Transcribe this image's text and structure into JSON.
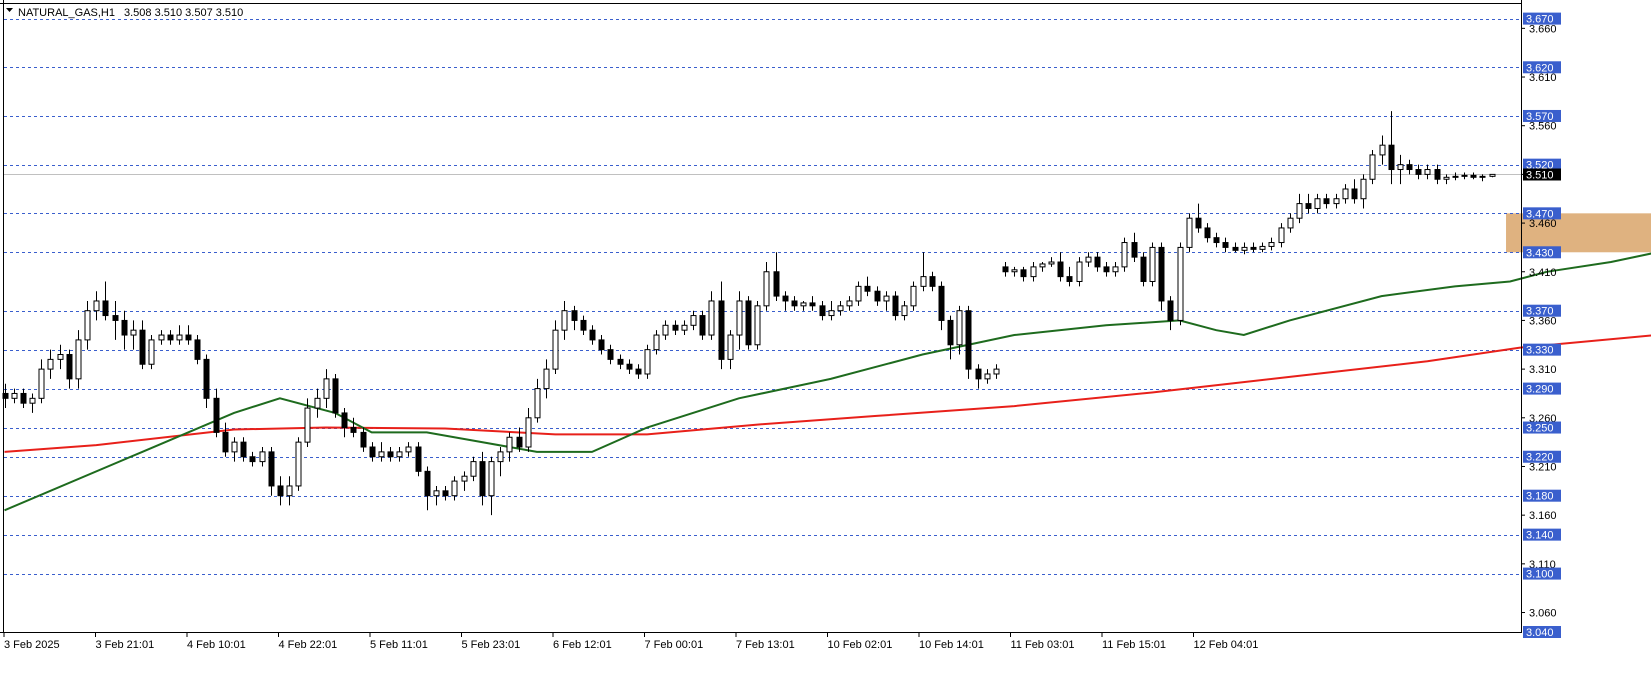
{
  "header": {
    "symbol": "NATURAL_GAS,H1",
    "ohlc": "3.508 3.510 3.507 3.510"
  },
  "colors": {
    "background": "#ffffff",
    "grid_dashed": "#3a5fcd",
    "level_label_bg": "#3a5fcd",
    "ma_fast": "#1e6b1e",
    "ma_slow": "#e8201a",
    "zone_fill": "#d9a56a",
    "bull_fill": "#ffffff",
    "bear_fill": "#000000",
    "candle_outline": "#000000",
    "current_price_bg": "#000000"
  },
  "chart_data": {
    "type": "candlestick",
    "symbol": "NATURAL_GAS",
    "timeframe": "H1",
    "ylim": [
      3.04,
      3.685
    ],
    "y_ticks": [
      "3.660",
      "3.610",
      "3.560",
      "3.510",
      "3.460",
      "3.410",
      "3.360",
      "3.310",
      "3.260",
      "3.210",
      "3.160",
      "3.110",
      "3.060"
    ],
    "levels": [
      "3.670",
      "3.620",
      "3.570",
      "3.520",
      "3.470",
      "3.430",
      "3.370",
      "3.330",
      "3.290",
      "3.250",
      "3.220",
      "3.180",
      "3.140",
      "3.100",
      "3.040"
    ],
    "current_price": "3.510",
    "x_labels": [
      "3 Feb 2025",
      "3 Feb 21:01",
      "4 Feb 10:01",
      "4 Feb 22:01",
      "5 Feb 11:01",
      "5 Feb 23:01",
      "6 Feb 12:01",
      "7 Feb 00:01",
      "7 Feb 13:01",
      "10 Feb 02:01",
      "10 Feb 14:01",
      "11 Feb 03:01",
      "11 Feb 15:01",
      "12 Feb 04:01"
    ],
    "zone": {
      "from_price": 3.43,
      "to_price": 3.47,
      "from_bar": 164,
      "to_bar": 222
    },
    "candles": [
      [
        3.285,
        3.295,
        3.27,
        3.28
      ],
      [
        3.28,
        3.29,
        3.275,
        3.285
      ],
      [
        3.285,
        3.29,
        3.27,
        3.275
      ],
      [
        3.275,
        3.285,
        3.265,
        3.28
      ],
      [
        3.28,
        3.32,
        3.275,
        3.31
      ],
      [
        3.31,
        3.33,
        3.3,
        3.32
      ],
      [
        3.32,
        3.335,
        3.31,
        3.325
      ],
      [
        3.325,
        3.33,
        3.29,
        3.3
      ],
      [
        3.3,
        3.35,
        3.29,
        3.34
      ],
      [
        3.34,
        3.38,
        3.33,
        3.37
      ],
      [
        3.37,
        3.39,
        3.36,
        3.38
      ],
      [
        3.38,
        3.4,
        3.36,
        3.365
      ],
      [
        3.365,
        3.38,
        3.34,
        3.36
      ],
      [
        3.36,
        3.37,
        3.33,
        3.345
      ],
      [
        3.345,
        3.36,
        3.33,
        3.35
      ],
      [
        3.35,
        3.36,
        3.31,
        3.315
      ],
      [
        3.315,
        3.345,
        3.31,
        3.34
      ],
      [
        3.34,
        3.35,
        3.335,
        3.345
      ],
      [
        3.345,
        3.35,
        3.335,
        3.34
      ],
      [
        3.34,
        3.355,
        3.335,
        3.345
      ],
      [
        3.345,
        3.355,
        3.335,
        3.34
      ],
      [
        3.34,
        3.345,
        3.315,
        3.32
      ],
      [
        3.32,
        3.325,
        3.27,
        3.28
      ],
      [
        3.28,
        3.29,
        3.24,
        3.245
      ],
      [
        3.245,
        3.255,
        3.22,
        3.225
      ],
      [
        3.225,
        3.24,
        3.215,
        3.235
      ],
      [
        3.235,
        3.24,
        3.215,
        3.22
      ],
      [
        3.22,
        3.225,
        3.21,
        3.215
      ],
      [
        3.215,
        3.23,
        3.21,
        3.225
      ],
      [
        3.225,
        3.23,
        3.18,
        3.19
      ],
      [
        3.19,
        3.2,
        3.17,
        3.18
      ],
      [
        3.18,
        3.2,
        3.17,
        3.19
      ],
      [
        3.19,
        3.24,
        3.185,
        3.235
      ],
      [
        3.235,
        3.28,
        3.23,
        3.27
      ],
      [
        3.27,
        3.29,
        3.26,
        3.28
      ],
      [
        3.28,
        3.31,
        3.27,
        3.3
      ],
      [
        3.3,
        3.305,
        3.26,
        3.265
      ],
      [
        3.265,
        3.27,
        3.24,
        3.25
      ],
      [
        3.25,
        3.26,
        3.24,
        3.245
      ],
      [
        3.245,
        3.25,
        3.225,
        3.23
      ],
      [
        3.23,
        3.235,
        3.215,
        3.22
      ],
      [
        3.22,
        3.235,
        3.215,
        3.225
      ],
      [
        3.225,
        3.23,
        3.215,
        3.22
      ],
      [
        3.22,
        3.23,
        3.215,
        3.225
      ],
      [
        3.225,
        3.235,
        3.22,
        3.23
      ],
      [
        3.23,
        3.235,
        3.2,
        3.205
      ],
      [
        3.205,
        3.21,
        3.165,
        3.18
      ],
      [
        3.18,
        3.19,
        3.17,
        3.185
      ],
      [
        3.185,
        3.19,
        3.175,
        3.18
      ],
      [
        3.18,
        3.2,
        3.175,
        3.195
      ],
      [
        3.195,
        3.205,
        3.185,
        3.2
      ],
      [
        3.2,
        3.22,
        3.195,
        3.215
      ],
      [
        3.215,
        3.225,
        3.17,
        3.18
      ],
      [
        3.18,
        3.22,
        3.16,
        3.215
      ],
      [
        3.215,
        3.23,
        3.2,
        3.225
      ],
      [
        3.225,
        3.245,
        3.215,
        3.24
      ],
      [
        3.24,
        3.25,
        3.225,
        3.23
      ],
      [
        3.23,
        3.27,
        3.225,
        3.26
      ],
      [
        3.26,
        3.3,
        3.255,
        3.29
      ],
      [
        3.29,
        3.32,
        3.28,
        3.31
      ],
      [
        3.31,
        3.36,
        3.305,
        3.35
      ],
      [
        3.35,
        3.38,
        3.34,
        3.37
      ],
      [
        3.37,
        3.375,
        3.35,
        3.36
      ],
      [
        3.36,
        3.365,
        3.345,
        3.35
      ],
      [
        3.35,
        3.355,
        3.335,
        3.34
      ],
      [
        3.34,
        3.345,
        3.325,
        3.33
      ],
      [
        3.33,
        3.335,
        3.315,
        3.32
      ],
      [
        3.32,
        3.325,
        3.31,
        3.315
      ],
      [
        3.315,
        3.32,
        3.305,
        3.31
      ],
      [
        3.31,
        3.315,
        3.3,
        3.305
      ],
      [
        3.305,
        3.335,
        3.3,
        3.33
      ],
      [
        3.33,
        3.35,
        3.325,
        3.345
      ],
      [
        3.345,
        3.36,
        3.34,
        3.355
      ],
      [
        3.355,
        3.36,
        3.345,
        3.35
      ],
      [
        3.35,
        3.36,
        3.345,
        3.355
      ],
      [
        3.355,
        3.37,
        3.35,
        3.365
      ],
      [
        3.365,
        3.37,
        3.34,
        3.345
      ],
      [
        3.345,
        3.39,
        3.34,
        3.38
      ],
      [
        3.38,
        3.4,
        3.31,
        3.32
      ],
      [
        3.32,
        3.35,
        3.31,
        3.345
      ],
      [
        3.345,
        3.39,
        3.33,
        3.38
      ],
      [
        3.38,
        3.385,
        3.33,
        3.335
      ],
      [
        3.335,
        3.38,
        3.33,
        3.375
      ],
      [
        3.375,
        3.42,
        3.37,
        3.41
      ],
      [
        3.41,
        3.43,
        3.38,
        3.385
      ],
      [
        3.385,
        3.39,
        3.37,
        3.38
      ],
      [
        3.38,
        3.385,
        3.37,
        3.375
      ],
      [
        3.375,
        3.38,
        3.37,
        3.378
      ],
      [
        3.378,
        3.385,
        3.37,
        3.375
      ],
      [
        3.375,
        3.38,
        3.36,
        3.365
      ],
      [
        3.365,
        3.38,
        3.36,
        3.37
      ],
      [
        3.37,
        3.38,
        3.365,
        3.375
      ],
      [
        3.375,
        3.385,
        3.37,
        3.38
      ],
      [
        3.38,
        3.4,
        3.375,
        3.395
      ],
      [
        3.395,
        3.405,
        3.385,
        3.39
      ],
      [
        3.39,
        3.395,
        3.375,
        3.38
      ],
      [
        3.38,
        3.39,
        3.37,
        3.385
      ],
      [
        3.385,
        3.39,
        3.36,
        3.365
      ],
      [
        3.365,
        3.38,
        3.36,
        3.375
      ],
      [
        3.375,
        3.4,
        3.37,
        3.395
      ],
      [
        3.395,
        3.43,
        3.39,
        3.405
      ],
      [
        3.405,
        3.41,
        3.39,
        3.395
      ],
      [
        3.395,
        3.4,
        3.35,
        3.36
      ],
      [
        3.36,
        3.365,
        3.32,
        3.335
      ],
      [
        3.335,
        3.375,
        3.325,
        3.37
      ],
      [
        3.37,
        3.375,
        3.3,
        3.31
      ],
      [
        3.31,
        3.315,
        3.29,
        3.3
      ],
      [
        3.3,
        3.31,
        3.295,
        3.305
      ],
      [
        3.305,
        3.315,
        3.3,
        3.31
      ],
      [
        3.415,
        3.42,
        3.405,
        3.41
      ],
      [
        3.41,
        3.415,
        3.405,
        3.412
      ],
      [
        3.412,
        3.415,
        3.4,
        3.405
      ],
      [
        3.405,
        3.42,
        3.4,
        3.415
      ],
      [
        3.415,
        3.42,
        3.41,
        3.418
      ],
      [
        3.418,
        3.425,
        3.415,
        3.42
      ],
      [
        3.42,
        3.43,
        3.4,
        3.405
      ],
      [
        3.405,
        3.415,
        3.395,
        3.4
      ],
      [
        3.4,
        3.425,
        3.395,
        3.42
      ],
      [
        3.42,
        3.43,
        3.415,
        3.425
      ],
      [
        3.425,
        3.43,
        3.41,
        3.415
      ],
      [
        3.415,
        3.42,
        3.405,
        3.41
      ],
      [
        3.41,
        3.42,
        3.405,
        3.415
      ],
      [
        3.415,
        3.445,
        3.41,
        3.44
      ],
      [
        3.44,
        3.45,
        3.42,
        3.425
      ],
      [
        3.425,
        3.43,
        3.395,
        3.4
      ],
      [
        3.4,
        3.44,
        3.395,
        3.435
      ],
      [
        3.435,
        3.44,
        3.37,
        3.38
      ],
      [
        3.38,
        3.385,
        3.35,
        3.36
      ],
      [
        3.36,
        3.44,
        3.355,
        3.435
      ],
      [
        3.435,
        3.47,
        3.43,
        3.465
      ],
      [
        3.465,
        3.48,
        3.45,
        3.455
      ],
      [
        3.455,
        3.46,
        3.44,
        3.445
      ],
      [
        3.445,
        3.45,
        3.435,
        3.44
      ],
      [
        3.44,
        3.445,
        3.43,
        3.435
      ],
      [
        3.435,
        3.44,
        3.43,
        3.432
      ],
      [
        3.432,
        3.44,
        3.428,
        3.435
      ],
      [
        3.435,
        3.44,
        3.43,
        3.433
      ],
      [
        3.433,
        3.44,
        3.43,
        3.436
      ],
      [
        3.436,
        3.445,
        3.432,
        3.44
      ],
      [
        3.44,
        3.46,
        3.435,
        3.455
      ],
      [
        3.455,
        3.47,
        3.45,
        3.465
      ],
      [
        3.465,
        3.49,
        3.46,
        3.48
      ],
      [
        3.48,
        3.49,
        3.47,
        3.475
      ],
      [
        3.475,
        3.49,
        3.47,
        3.485
      ],
      [
        3.485,
        3.49,
        3.475,
        3.48
      ],
      [
        3.48,
        3.49,
        3.475,
        3.485
      ],
      [
        3.485,
        3.5,
        3.48,
        3.495
      ],
      [
        3.495,
        3.505,
        3.48,
        3.485
      ],
      [
        3.485,
        3.51,
        3.475,
        3.505
      ],
      [
        3.505,
        3.535,
        3.5,
        3.53
      ],
      [
        3.53,
        3.55,
        3.52,
        3.54
      ],
      [
        3.54,
        3.575,
        3.5,
        3.515
      ],
      [
        3.515,
        3.53,
        3.5,
        3.52
      ],
      [
        3.52,
        3.525,
        3.51,
        3.515
      ],
      [
        3.515,
        3.52,
        3.505,
        3.51
      ],
      [
        3.51,
        3.52,
        3.505,
        3.515
      ],
      [
        3.515,
        3.52,
        3.5,
        3.505
      ],
      [
        3.505,
        3.51,
        3.5,
        3.507
      ],
      [
        3.507,
        3.512,
        3.504,
        3.508
      ],
      [
        3.508,
        3.512,
        3.505,
        3.509
      ],
      [
        3.509,
        3.512,
        3.505,
        3.507
      ],
      [
        3.507,
        3.51,
        3.503,
        3.508
      ],
      [
        3.508,
        3.51,
        3.507,
        3.51
      ]
    ],
    "ma_fast_points": [
      [
        0,
        3.165
      ],
      [
        15,
        3.225
      ],
      [
        25,
        3.265
      ],
      [
        30,
        3.28
      ],
      [
        36,
        3.265
      ],
      [
        40,
        3.245
      ],
      [
        46,
        3.245
      ],
      [
        52,
        3.235
      ],
      [
        58,
        3.225
      ],
      [
        64,
        3.225
      ],
      [
        70,
        3.25
      ],
      [
        80,
        3.28
      ],
      [
        90,
        3.3
      ],
      [
        100,
        3.325
      ],
      [
        110,
        3.345
      ],
      [
        120,
        3.355
      ],
      [
        128,
        3.36
      ],
      [
        132,
        3.35
      ],
      [
        135,
        3.345
      ],
      [
        140,
        3.36
      ],
      [
        150,
        3.385
      ],
      [
        158,
        3.395
      ],
      [
        164,
        3.4
      ],
      [
        168,
        3.41
      ],
      [
        175,
        3.42
      ],
      [
        180,
        3.43
      ],
      [
        187,
        3.44
      ],
      [
        195,
        3.46
      ],
      [
        205,
        3.48
      ],
      [
        212,
        3.49
      ],
      [
        217,
        3.493
      ]
    ],
    "ma_slow_points": [
      [
        0,
        3.225
      ],
      [
        10,
        3.232
      ],
      [
        25,
        3.248
      ],
      [
        35,
        3.25
      ],
      [
        48,
        3.249
      ],
      [
        60,
        3.243
      ],
      [
        70,
        3.243
      ],
      [
        82,
        3.253
      ],
      [
        95,
        3.262
      ],
      [
        110,
        3.272
      ],
      [
        125,
        3.286
      ],
      [
        140,
        3.302
      ],
      [
        155,
        3.318
      ],
      [
        165,
        3.332
      ],
      [
        180,
        3.345
      ],
      [
        195,
        3.362
      ],
      [
        205,
        3.375
      ],
      [
        217,
        3.385
      ]
    ]
  }
}
